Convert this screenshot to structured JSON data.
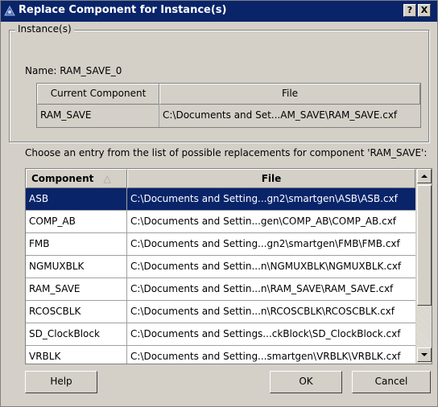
{
  "window": {
    "title": "Replace Component for Instance(s)",
    "help_glyph": "?",
    "close_glyph": "X"
  },
  "instances": {
    "legend": "Instance(s)",
    "name_line": "Name: RAM_SAVE_0",
    "columns": [
      "Current Component",
      "File"
    ],
    "row": {
      "component": "RAM_SAVE",
      "file": "C:\\Documents and Set...AM_SAVE\\RAM_SAVE.cxf"
    }
  },
  "prompt": "Choose an entry from the list of possible replacements for component 'RAM_SAVE':",
  "list": {
    "columns": [
      "Component",
      "File"
    ],
    "sort_glyph": "△",
    "selected_index": 0,
    "rows": [
      {
        "component": "ASB",
        "file": "C:\\Documents and Setting...gn2\\smartgen\\ASB\\ASB.cxf"
      },
      {
        "component": "COMP_AB",
        "file": "C:\\Documents and Settin...gen\\COMP_AB\\COMP_AB.cxf"
      },
      {
        "component": "FMB",
        "file": "C:\\Documents and Setting...gn2\\smartgen\\FMB\\FMB.cxf"
      },
      {
        "component": "NGMUXBLK",
        "file": "C:\\Documents and Settin...n\\NGMUXBLK\\NGMUXBLK.cxf"
      },
      {
        "component": "RAM_SAVE",
        "file": "C:\\Documents and Settin...n\\RAM_SAVE\\RAM_SAVE.cxf"
      },
      {
        "component": "RCOSCBLK",
        "file": "C:\\Documents and Settin...n\\RCOSCBLK\\RCOSCBLK.cxf"
      },
      {
        "component": "SD_ClockBlock",
        "file": "C:\\Documents and Settings...ckBlock\\SD_ClockBlock.cxf"
      },
      {
        "component": "VRBLK",
        "file": "C:\\Documents and Setting...smartgen\\VRBLK\\VRBLK.cxf"
      }
    ]
  },
  "buttons": {
    "help": "Help",
    "ok": "OK",
    "cancel": "Cancel"
  },
  "colors": {
    "title_bar": "#0a246a",
    "selection": "#0a246a",
    "face": "#d4d0c8"
  }
}
